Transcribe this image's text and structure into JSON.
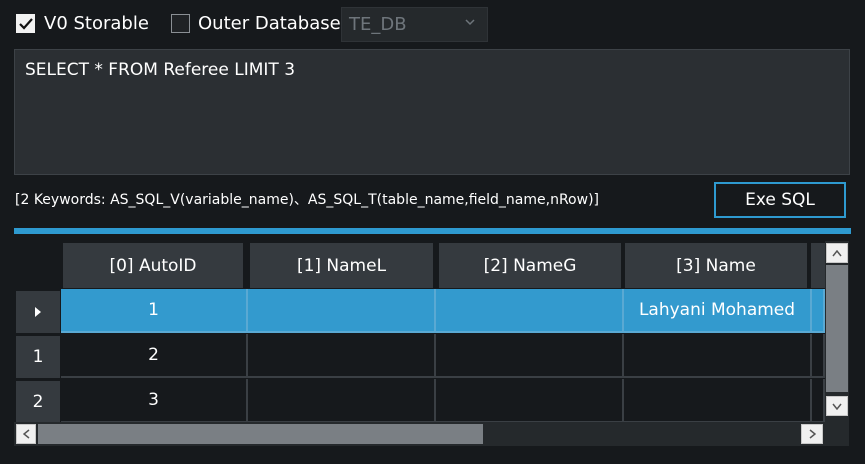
{
  "top": {
    "v0_storable": {
      "label": "V0 Storable",
      "checked": true
    },
    "outer_database": {
      "label": "Outer Database",
      "checked": false
    },
    "db_select": {
      "value": "TE_DB"
    }
  },
  "sql": {
    "text": "SELECT * FROM Referee LIMIT 3"
  },
  "hint": "[2 Keywords: AS_SQL_V(variable_name)、AS_SQL_T(table_name,field_name,nRow)]",
  "exe_button": "Exe SQL",
  "colors": {
    "accent": "#2e9ad0",
    "selected_row": "#339ace",
    "header_bg": "#353a3f"
  },
  "grid": {
    "columns": [
      "[0] AutoID",
      "[1] NameL",
      "[2] NameG",
      "[3] Name"
    ],
    "row_headers": [
      "▸",
      "1",
      "2"
    ],
    "rows": [
      [
        "1",
        "",
        "",
        "Lahyani Mohamed"
      ],
      [
        "2",
        "",
        "",
        ""
      ],
      [
        "3",
        "",
        "",
        ""
      ]
    ],
    "selected_row": 0
  }
}
